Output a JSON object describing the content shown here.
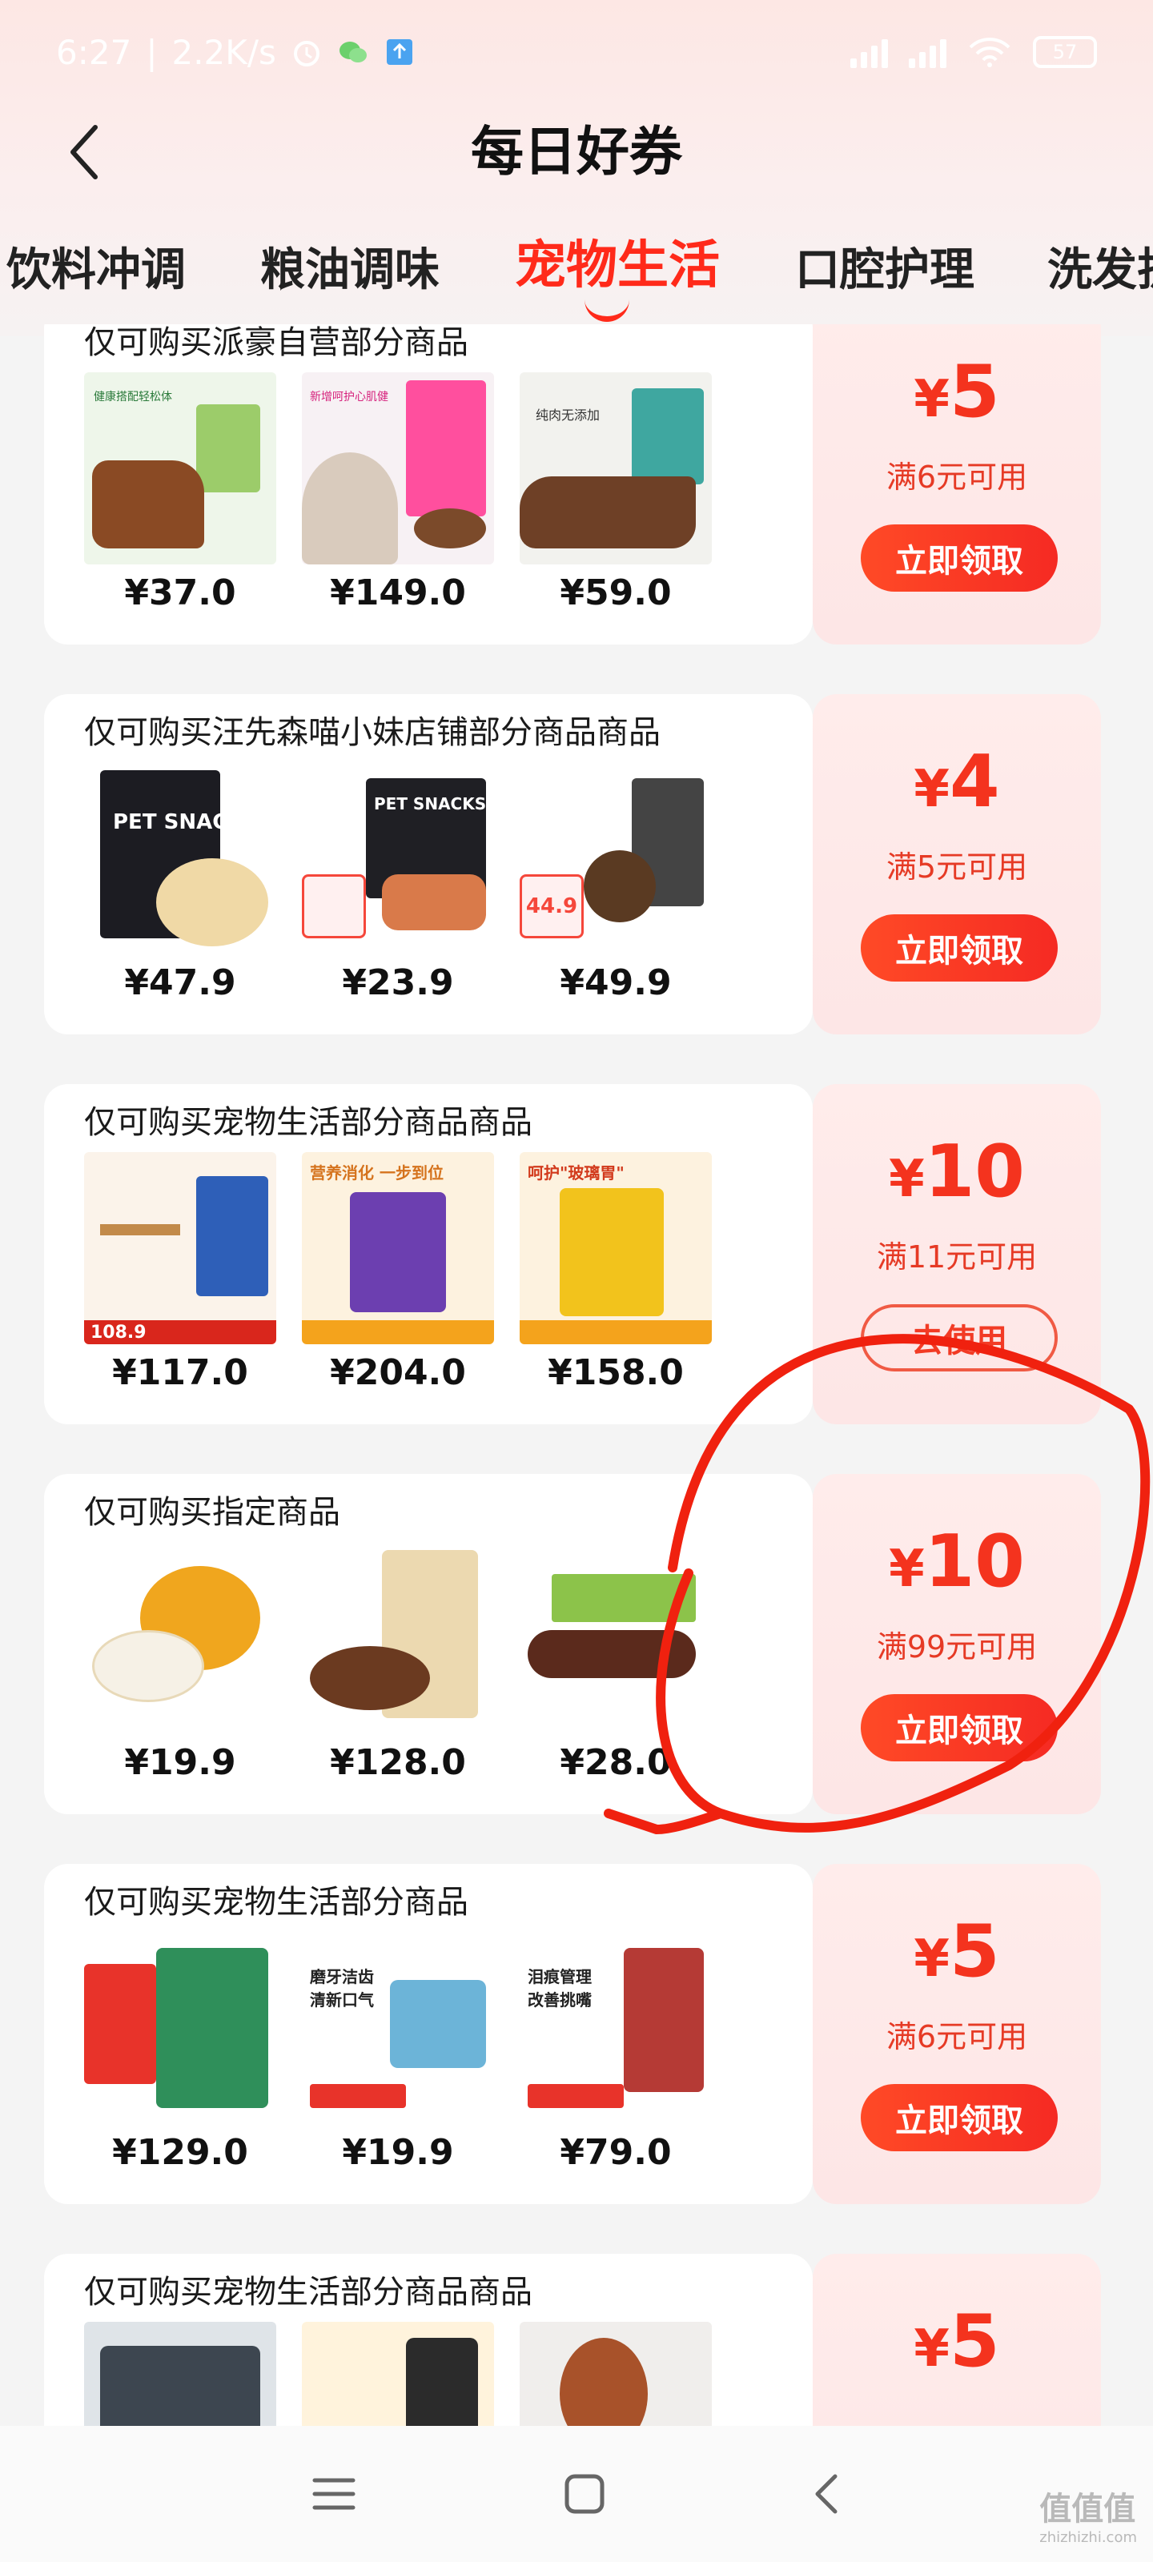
{
  "status_bar": {
    "time": "6:27",
    "speed": "2.2K/s",
    "battery": "57"
  },
  "header": {
    "title": "每日好券"
  },
  "tabs": [
    {
      "label": "饮料冲调",
      "active": false
    },
    {
      "label": "粮油调味",
      "active": false
    },
    {
      "label": "宠物生活",
      "active": true
    },
    {
      "label": "口腔护理",
      "active": false
    },
    {
      "label": "洗发护",
      "active": false
    }
  ],
  "coupons": [
    {
      "title": "仅可购买派豪自营部分商品",
      "prices": [
        "¥37.0",
        "¥149.0",
        "¥59.0"
      ],
      "amount": "5",
      "yen": "¥",
      "condition": "满6元可用",
      "button": "立即领取",
      "used": false
    },
    {
      "title": "仅可购买汪先森喵小妹店铺部分商品商品",
      "prices": [
        "¥47.9",
        "¥23.9",
        "¥49.9"
      ],
      "amount": "4",
      "yen": "¥",
      "condition": "满5元可用",
      "button": "立即领取",
      "used": false
    },
    {
      "title": "仅可购买宠物生活部分商品商品",
      "prices": [
        "¥117.0",
        "¥204.0",
        "¥158.0"
      ],
      "amount": "10",
      "yen": "¥",
      "condition": "满11元可用",
      "button": "去使用",
      "used": true
    },
    {
      "title": "仅可购买指定商品",
      "prices": [
        "¥19.9",
        "¥128.0",
        "¥28.0"
      ],
      "amount": "10",
      "yen": "¥",
      "condition": "满99元可用",
      "button": "立即领取",
      "used": false
    },
    {
      "title": "仅可购买宠物生活部分商品",
      "prices": [
        "¥129.0",
        "¥19.9",
        "¥79.0"
      ],
      "amount": "5",
      "yen": "¥",
      "condition": "满6元可用",
      "button": "立即领取",
      "used": false
    },
    {
      "title": "仅可购买宠物生活部分商品商品",
      "prices": [
        "",
        "",
        ""
      ],
      "amount": "5",
      "yen": "¥",
      "condition": "",
      "button": "",
      "used": false
    }
  ],
  "product_image_labels": {
    "c0p0": "健康搭配轻松体",
    "c0p1": "新增呵护心肌健",
    "c0p2": "纯肉无添加",
    "c1p0": "PET SNACKS",
    "c1p1": "PET SNACKS",
    "c1p2": "44.9",
    "c2p0": "108.9",
    "c2p1": "营养消化 一步到位",
    "c2p2": "呵护\"玻璃胃\"",
    "c4p1": "磨牙洁齿 清新口气",
    "c4p2": "泪痕管理 改善挑嘴"
  },
  "watermark": {
    "text": "值值值",
    "sub": "zhizhizhi.com"
  },
  "colors": {
    "accent": "#f4331e",
    "tab_active": "#ff2a1a",
    "coupon_bg": "#ffeceb"
  }
}
